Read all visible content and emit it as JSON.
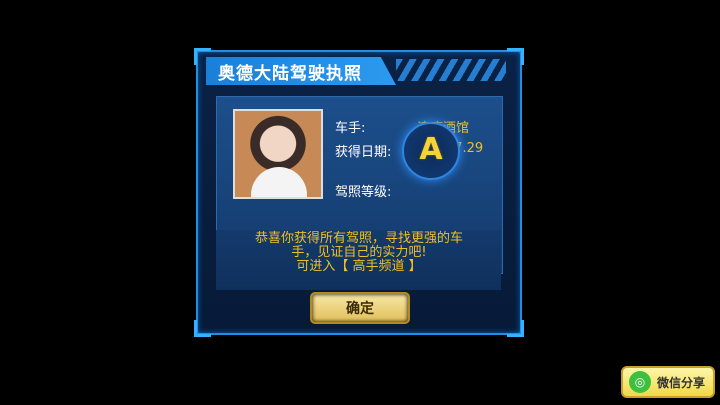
{
  "dialog": {
    "title": "奥德大陆驾驶执照",
    "driver_label": "车手:",
    "driver_name": "浪瘾酒馆",
    "date_label": "获得日期:",
    "date_value": "2017.7.29",
    "grade_label": "驾照等级:",
    "grade_value": "A",
    "message": "恭喜你获得所有驾照，寻找更强的车手，见证自己的实力吧!",
    "message_cta": "可进入【 高手频道 】",
    "confirm_label": "确定"
  },
  "share": {
    "label": "微信分享",
    "icon": "wechat-icon"
  }
}
